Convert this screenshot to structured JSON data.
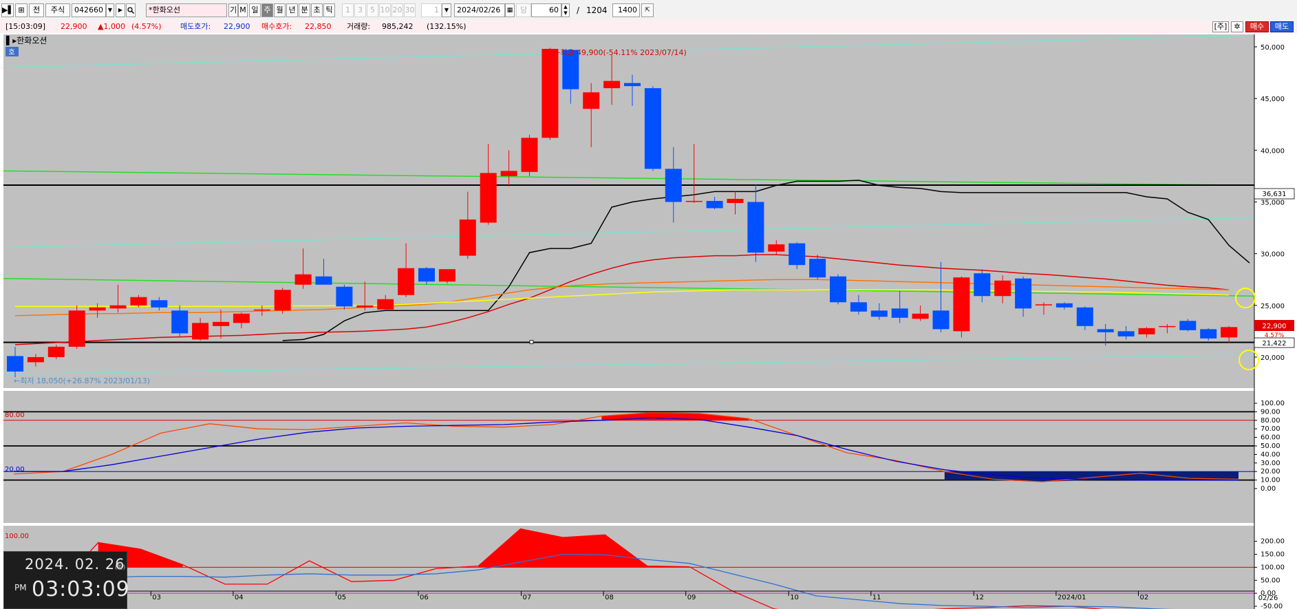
{
  "toolbar": {
    "buttons": [
      "▶▌",
      "⊞",
      "전",
      "주식"
    ],
    "code": "042660",
    "search_name": "*한화오선",
    "period_btns": [
      "기",
      "M",
      "일",
      "주",
      "월",
      "년",
      "분",
      "초",
      "틱"
    ],
    "selected_period": "주",
    "interval_btns": [
      "1",
      "3",
      "5",
      "10",
      "20",
      "30"
    ],
    "count_field": "1",
    "date": "2024/02/26",
    "dang_label": "당",
    "bars_value": "60",
    "slash": "/",
    "total_value": "1204",
    "width_value": "1400"
  },
  "infobar": {
    "time": "[15:03:09]",
    "price": "22,900",
    "change": "▲1,000",
    "change_pct": "(4.57%)",
    "ask_label": "매도호가:",
    "ask_value": "22,900",
    "bid_label": "매수호가:",
    "bid_value": "22,850",
    "volume_label": "거래량:",
    "volume_value": "985,242",
    "volume_pct": "(132.15%)",
    "right_tag": "[주]",
    "buy_button": "매수",
    "sell_button": "매도"
  },
  "chart_head": {
    "title": "▌▸한화오션",
    "badge": "호",
    "high_annotation": "←최고 49,900(-54.11% 2023/07/14)",
    "low_annotation": "←최저 18,050(+26.87% 2023/01/13)",
    "hline_label_upper": "36,631",
    "hline_label_lower": "21,422",
    "current_price_label": "22,900",
    "current_pct_label": "4.57%",
    "stoch_hi_label": "80.00",
    "stoch_lo_label": "20.00",
    "osc_label": "100.00",
    "bottom_date_label": "02/26"
  },
  "chart_data": [
    {
      "type": "candlestick",
      "x_labels": [
        "03",
        "04",
        "05",
        "06",
        "07",
        "08",
        "09",
        "10",
        "11",
        "12",
        "2024/01",
        "02"
      ],
      "y_ticks": [
        20000,
        25000,
        30000,
        35000,
        40000,
        45000,
        50000
      ],
      "ylim": [
        17200,
        51000
      ],
      "candles": [
        {
          "o": 20100,
          "h": 21000,
          "l": 18050,
          "c": 18600
        },
        {
          "o": 19500,
          "h": 20300,
          "l": 19100,
          "c": 20000
        },
        {
          "o": 20000,
          "h": 21200,
          "l": 19800,
          "c": 21000
        },
        {
          "o": 21000,
          "h": 25000,
          "l": 20800,
          "c": 24500
        },
        {
          "o": 24500,
          "h": 25200,
          "l": 23800,
          "c": 24800
        },
        {
          "o": 24700,
          "h": 27000,
          "l": 24300,
          "c": 25000
        },
        {
          "o": 25000,
          "h": 26000,
          "l": 24800,
          "c": 25800
        },
        {
          "o": 25500,
          "h": 25800,
          "l": 24500,
          "c": 24800
        },
        {
          "o": 24500,
          "h": 25000,
          "l": 22000,
          "c": 22300
        },
        {
          "o": 21700,
          "h": 23800,
          "l": 21600,
          "c": 23300
        },
        {
          "o": 23000,
          "h": 24600,
          "l": 21800,
          "c": 23400
        },
        {
          "o": 23300,
          "h": 24300,
          "l": 22800,
          "c": 24200
        },
        {
          "o": 24500,
          "h": 25000,
          "l": 24000,
          "c": 24600
        },
        {
          "o": 24500,
          "h": 26700,
          "l": 24200,
          "c": 26500
        },
        {
          "o": 27000,
          "h": 30500,
          "l": 26600,
          "c": 28000
        },
        {
          "o": 27800,
          "h": 29500,
          "l": 27000,
          "c": 27000
        },
        {
          "o": 26800,
          "h": 27000,
          "l": 24600,
          "c": 24900
        },
        {
          "o": 24800,
          "h": 27300,
          "l": 24500,
          "c": 25000
        },
        {
          "o": 24600,
          "h": 26000,
          "l": 24500,
          "c": 25600
        },
        {
          "o": 26000,
          "h": 31000,
          "l": 25800,
          "c": 28600
        },
        {
          "o": 28600,
          "h": 28700,
          "l": 27000,
          "c": 27300
        },
        {
          "o": 27300,
          "h": 28500,
          "l": 27100,
          "c": 28500
        },
        {
          "o": 29800,
          "h": 36000,
          "l": 29500,
          "c": 33300
        },
        {
          "o": 33000,
          "h": 40600,
          "l": 32800,
          "c": 37800
        },
        {
          "o": 37500,
          "h": 40000,
          "l": 36500,
          "c": 38000
        },
        {
          "o": 37900,
          "h": 41500,
          "l": 37500,
          "c": 41200
        },
        {
          "o": 41200,
          "h": 49900,
          "l": 41000,
          "c": 49800
        },
        {
          "o": 49700,
          "h": 49800,
          "l": 44500,
          "c": 45900
        },
        {
          "o": 44000,
          "h": 46500,
          "l": 40300,
          "c": 45600
        },
        {
          "o": 46000,
          "h": 49200,
          "l": 44400,
          "c": 46700
        },
        {
          "o": 46500,
          "h": 47300,
          "l": 44300,
          "c": 46200
        },
        {
          "o": 46000,
          "h": 46200,
          "l": 38000,
          "c": 38200
        },
        {
          "o": 38200,
          "h": 40300,
          "l": 33000,
          "c": 35000
        },
        {
          "o": 35000,
          "h": 40600,
          "l": 34900,
          "c": 35100
        },
        {
          "o": 35100,
          "h": 35500,
          "l": 34300,
          "c": 34400
        },
        {
          "o": 34900,
          "h": 36000,
          "l": 33800,
          "c": 35300
        },
        {
          "o": 35000,
          "h": 36700,
          "l": 29200,
          "c": 30100
        },
        {
          "o": 30200,
          "h": 31300,
          "l": 29900,
          "c": 30900
        },
        {
          "o": 31000,
          "h": 31100,
          "l": 28500,
          "c": 28900
        },
        {
          "o": 29500,
          "h": 29900,
          "l": 27500,
          "c": 27700
        },
        {
          "o": 27800,
          "h": 28000,
          "l": 25100,
          "c": 25300
        },
        {
          "o": 25300,
          "h": 26000,
          "l": 24100,
          "c": 24400
        },
        {
          "o": 24500,
          "h": 25200,
          "l": 23600,
          "c": 23900
        },
        {
          "o": 24700,
          "h": 26400,
          "l": 23300,
          "c": 23800
        },
        {
          "o": 23700,
          "h": 25000,
          "l": 23500,
          "c": 24200
        },
        {
          "o": 24500,
          "h": 29200,
          "l": 22400,
          "c": 22700
        },
        {
          "o": 22500,
          "h": 27800,
          "l": 21900,
          "c": 27700
        },
        {
          "o": 28100,
          "h": 28500,
          "l": 25300,
          "c": 25900
        },
        {
          "o": 25900,
          "h": 27900,
          "l": 25200,
          "c": 27400
        },
        {
          "o": 27600,
          "h": 27800,
          "l": 23900,
          "c": 24700
        },
        {
          "o": 25000,
          "h": 25300,
          "l": 24100,
          "c": 25100
        },
        {
          "o": 25200,
          "h": 25300,
          "l": 24600,
          "c": 24800
        },
        {
          "o": 24800,
          "h": 24900,
          "l": 22600,
          "c": 23000
        },
        {
          "o": 22700,
          "h": 23200,
          "l": 21100,
          "c": 22400
        },
        {
          "o": 22500,
          "h": 23000,
          "l": 21700,
          "c": 22000
        },
        {
          "o": 22200,
          "h": 22900,
          "l": 21900,
          "c": 22800
        },
        {
          "o": 22900,
          "h": 23200,
          "l": 22300,
          "c": 23000
        },
        {
          "o": 23500,
          "h": 23700,
          "l": 22500,
          "c": 22600
        },
        {
          "o": 22700,
          "h": 22800,
          "l": 21600,
          "c": 21800
        },
        {
          "o": 21900,
          "h": 23000,
          "l": 21400,
          "c": 22900
        }
      ],
      "series": [
        {
          "color": "#000000",
          "values": [
            null,
            null,
            null,
            null,
            null,
            null,
            null,
            null,
            null,
            null,
            null,
            null,
            null,
            21600,
            21700,
            22200,
            23500,
            24300,
            24500,
            24500,
            24500,
            24500,
            24500,
            24500,
            26800,
            30100,
            30500,
            30500,
            31000,
            34500,
            35000,
            35300,
            35500,
            35700,
            36000,
            36000,
            36000,
            36600,
            37000,
            37000,
            37000,
            37100,
            36600,
            36400,
            36300,
            36000,
            35900,
            35900,
            35900,
            35900,
            35900,
            35900,
            35900,
            35900,
            35900,
            35500,
            35300,
            34000,
            33300,
            30800,
            29100
          ]
        },
        {
          "color": "#e00000",
          "values": [
            21200,
            21300,
            21400,
            21500,
            21600,
            21700,
            21800,
            21900,
            21950,
            22000,
            22050,
            22100,
            22200,
            22300,
            22350,
            22400,
            22450,
            22500,
            22600,
            22700,
            22900,
            23300,
            23800,
            24400,
            25100,
            25700,
            26500,
            27300,
            28000,
            28600,
            29100,
            29400,
            29600,
            29700,
            29800,
            29800,
            29900,
            29900,
            29800,
            29700,
            29500,
            29300,
            29100,
            28900,
            28750,
            28600,
            28500,
            28400,
            28250,
            28100,
            28000,
            27850,
            27700,
            27550,
            27350,
            27150,
            26950,
            26800,
            26700,
            26500
          ]
        },
        {
          "color": "#ff7400",
          "values": [
            24000,
            24050,
            24100,
            24150,
            24200,
            24200,
            24250,
            24300,
            24300,
            24300,
            24350,
            24400,
            24450,
            24500,
            24550,
            24600,
            24700,
            24800,
            24900,
            25000,
            25100,
            25300,
            25600,
            25900,
            26200,
            26500,
            26700,
            26900,
            27000,
            27100,
            27150,
            27200,
            27250,
            27300,
            27350,
            27400,
            27450,
            27500,
            27500,
            27500,
            27450,
            27400,
            27350,
            27300,
            27250,
            27200,
            27150,
            27100,
            27050,
            27000,
            26950,
            26900,
            26850,
            26800,
            26750,
            26700,
            26650,
            26600,
            26550,
            26500
          ]
        },
        {
          "color": "#ffff00",
          "values": [
            24900,
            24900,
            24900,
            24900,
            24900,
            24900,
            24900,
            24900,
            24900,
            24900,
            24900,
            24900,
            24900,
            24950,
            24950,
            24950,
            25000,
            25000,
            25000,
            25100,
            25200,
            25300,
            25400,
            25500,
            25600,
            25700,
            25800,
            25900,
            26000,
            26100,
            26200,
            26300,
            26350,
            26400,
            26450,
            26500,
            26500,
            26500,
            26500,
            26500,
            26500,
            26500,
            26500,
            26500,
            26500,
            26500,
            26450,
            26450,
            26400,
            26400,
            26350,
            26350,
            26300,
            26300,
            26250,
            26200,
            26150,
            26100,
            26050,
            26000
          ]
        }
      ],
      "horizontal_lines": [
        36631,
        21422
      ],
      "current_price": 22900
    },
    {
      "type": "line",
      "name": "stochastic",
      "y_ticks": [
        0,
        10,
        20,
        30,
        40,
        50,
        60,
        70,
        80,
        90,
        100
      ],
      "levels": [
        80,
        20
      ],
      "series": [
        {
          "color": "#ff4500",
          "values": [
            17,
            20,
            40,
            65,
            76,
            70,
            69,
            73,
            77,
            73,
            72,
            75,
            85,
            89,
            88,
            82,
            62,
            42,
            33,
            20,
            11,
            8,
            13,
            18,
            12,
            11
          ]
        },
        {
          "color": "#0000e0",
          "values": [
            20,
            20,
            28,
            38,
            48,
            58,
            66,
            71,
            73,
            74,
            75,
            78,
            80,
            83,
            81,
            72,
            62,
            46,
            32,
            22,
            16,
            12,
            11,
            10,
            10,
            10
          ]
        }
      ]
    },
    {
      "type": "line",
      "name": "oscillator",
      "y_ticks": [
        -50,
        0,
        50,
        100,
        150,
        200
      ],
      "levels": [
        100,
        0
      ],
      "series": [
        {
          "color": "#ff0000",
          "values": [
            -50,
            20,
            195,
            170,
            110,
            35,
            35,
            125,
            45,
            50,
            95,
            105,
            248,
            215,
            225,
            105,
            102,
            10,
            -60,
            -80,
            -75,
            -70,
            -60,
            -55,
            -48,
            -50,
            -65,
            -80,
            -72,
            -88
          ]
        },
        {
          "color": "#3070d0",
          "values": [
            -50,
            40,
            60,
            65,
            65,
            62,
            70,
            75,
            70,
            70,
            75,
            90,
            120,
            150,
            148,
            130,
            115,
            75,
            35,
            -10,
            -25,
            -40,
            -47,
            -50,
            -55,
            -50,
            -52,
            -60,
            -65,
            -70
          ]
        }
      ]
    }
  ],
  "clock": {
    "date": "2024. 02. 26",
    "weekday": "(월)",
    "ampm": "PM",
    "time": "03:03:09"
  }
}
